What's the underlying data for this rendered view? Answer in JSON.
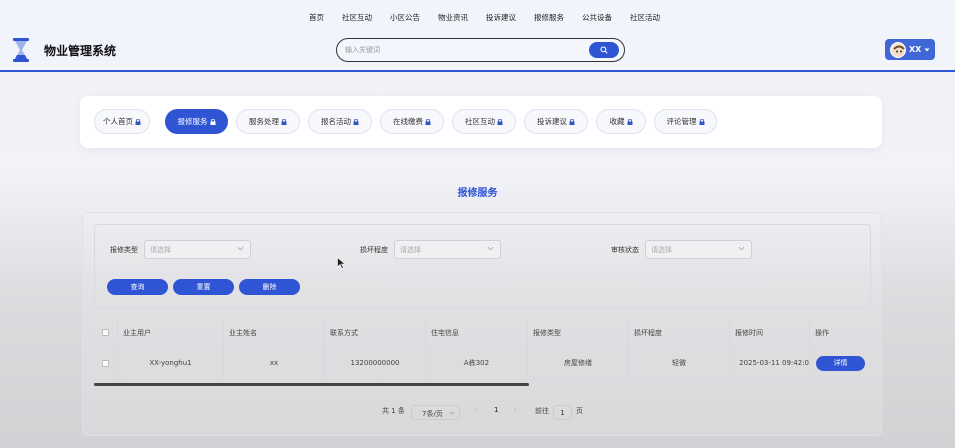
{
  "topnav": [
    "首页",
    "社区互动",
    "小区公告",
    "物业资讯",
    "投诉建议",
    "报修服务",
    "公共设备",
    "社区活动"
  ],
  "site_title": "物业管理系统",
  "search": {
    "placeholder": "输入关键词"
  },
  "user": {
    "name": "XX"
  },
  "tabs": [
    {
      "label": "个人首页",
      "active": false
    },
    {
      "label": "报修服务",
      "active": true
    },
    {
      "label": "服务处理",
      "active": false
    },
    {
      "label": "报名活动",
      "active": false
    },
    {
      "label": "在线缴费",
      "active": false
    },
    {
      "label": "社区互动",
      "active": false
    },
    {
      "label": "投诉建议",
      "active": false
    },
    {
      "label": "收藏",
      "active": false
    },
    {
      "label": "评论管理",
      "active": false
    }
  ],
  "page_heading": "报修服务",
  "filters": [
    {
      "label": "报修类型",
      "placeholder": "请选择"
    },
    {
      "label": "损坏程度",
      "placeholder": "请选择"
    },
    {
      "label": "审核状态",
      "placeholder": "请选择"
    }
  ],
  "buttons": {
    "query": "查询",
    "reset": "重置",
    "delete": "删除"
  },
  "table": {
    "headers": [
      "业主用户",
      "业主姓名",
      "联系方式",
      "住宅信息",
      "报修类型",
      "损坏程度",
      "报修时间",
      "操作"
    ],
    "rows": [
      [
        "XX-yonghu1",
        "xx",
        "13200000000",
        "A栋302",
        "房屋修缮",
        "轻微",
        "2025-03-11 09:42:0",
        "详情"
      ]
    ]
  },
  "pagination": {
    "total": "共 1 条",
    "page_size": "7条/页",
    "prev": "‹",
    "current": "1",
    "next": "›",
    "goto_label": "前往",
    "goto_value": "1",
    "page_suffix": "页"
  },
  "colors": {
    "accent": "#2f55d4"
  }
}
